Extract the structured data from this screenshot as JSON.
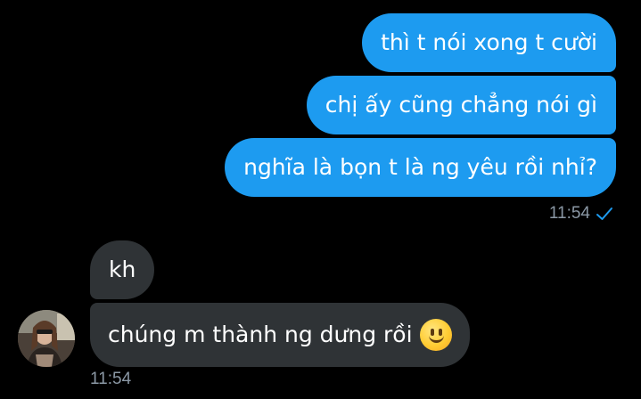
{
  "sent_messages": [
    {
      "text": "thì t nói xong t cười"
    },
    {
      "text": "chị ấy cũng chẳng nói gì"
    },
    {
      "text": "nghĩa là bọn t là ng yêu rồi nhỉ?"
    }
  ],
  "sent_time": "11:54",
  "received_messages": [
    {
      "text": "kh"
    },
    {
      "text": "chúng m thành ng dưng rồi",
      "emoji": "slightly-smiling-face"
    }
  ],
  "received_time": "11:54",
  "colors": {
    "background": "#000000",
    "sent_bubble": "#1d9bf0",
    "received_bubble": "#2f3336",
    "timestamp": "#8b98a5",
    "read_check": "#1d9bf0"
  },
  "icons": {
    "read_status": "check-icon",
    "contact": "avatar"
  }
}
